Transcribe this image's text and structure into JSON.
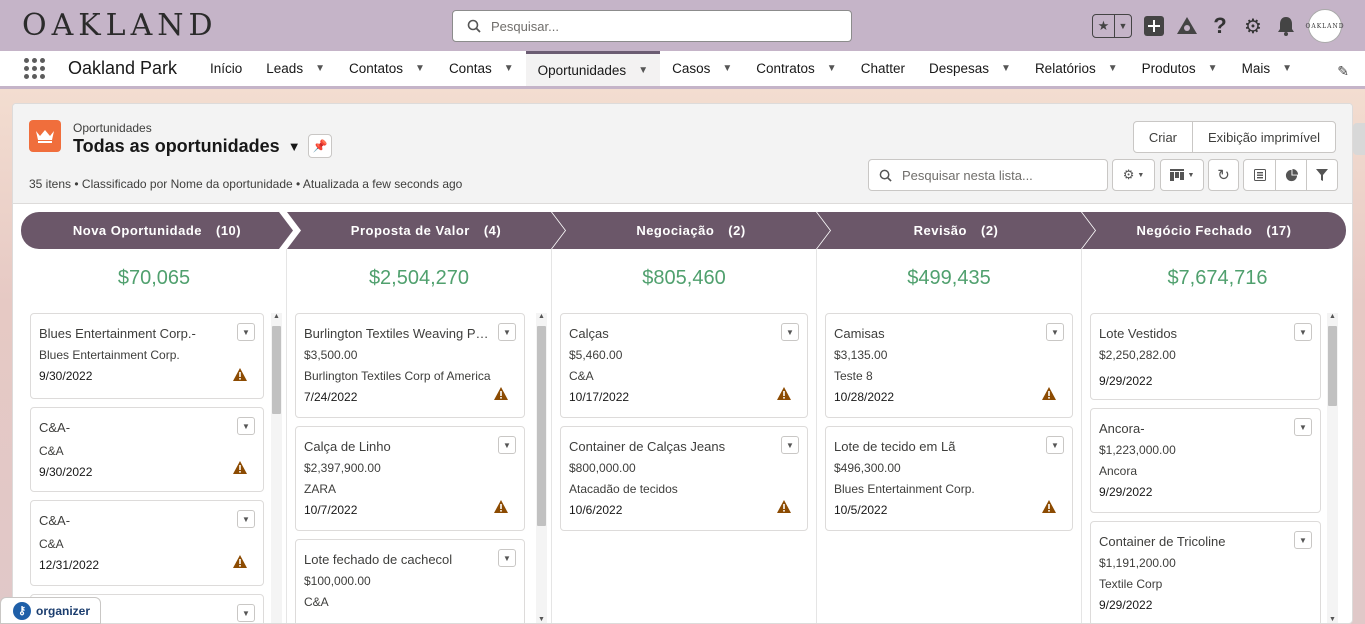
{
  "header": {
    "logo": "OAKLAND",
    "search_placeholder": "Pesquisar...",
    "avatar_text": "OAKLAND"
  },
  "nav": {
    "app_name": "Oakland Park",
    "items": [
      {
        "label": "Início",
        "chevron": false
      },
      {
        "label": "Leads",
        "chevron": true
      },
      {
        "label": "Contatos",
        "chevron": true
      },
      {
        "label": "Contas",
        "chevron": true
      },
      {
        "label": "Oportunidades",
        "chevron": true,
        "active": true
      },
      {
        "label": "Casos",
        "chevron": true
      },
      {
        "label": "Contratos",
        "chevron": true
      },
      {
        "label": "Chatter",
        "chevron": false
      },
      {
        "label": "Despesas",
        "chevron": true
      },
      {
        "label": "Relatórios",
        "chevron": true
      },
      {
        "label": "Produtos",
        "chevron": true
      },
      {
        "label": "Mais",
        "chevron": true
      }
    ]
  },
  "list": {
    "object_label": "Oportunidades",
    "title": "Todas as oportunidades",
    "meta": "35 itens • Classificado por Nome da oportunidade • Atualizada a few seconds ago",
    "btn_create": "Criar",
    "btn_print": "Exibição imprimível",
    "search_placeholder": "Pesquisar nesta lista..."
  },
  "stages": [
    {
      "name": "Nova Oportunidade",
      "count": "(10)",
      "sum": "$70,065",
      "cards": [
        {
          "name": "Blues Entertainment Corp.-",
          "lines": [
            "Blues Entertainment Corp."
          ],
          "date": "9/30/2022",
          "warn": true
        },
        {
          "name": "C&A-",
          "lines": [
            "C&A"
          ],
          "date": "9/30/2022",
          "warn": true
        },
        {
          "name": "C&A-",
          "lines": [
            "C&A"
          ],
          "date": "12/31/2022",
          "warn": true
        }
      ]
    },
    {
      "name": "Proposta de Valor",
      "count": "(4)",
      "sum": "$2,504,270",
      "cards": [
        {
          "name": "Burlington Textiles Weaving Pla...",
          "lines": [
            "$3,500.00",
            "Burlington Textiles Corp of America"
          ],
          "date": "7/24/2022",
          "warn": true
        },
        {
          "name": "Calça de Linho",
          "lines": [
            "$2,397,900.00",
            "ZARA"
          ],
          "date": "10/7/2022",
          "warn": true
        },
        {
          "name": "Lote fechado de cachecol",
          "lines": [
            "$100,000.00",
            "C&A"
          ],
          "date": "",
          "warn": true
        }
      ]
    },
    {
      "name": "Negociação",
      "count": "(2)",
      "sum": "$805,460",
      "cards": [
        {
          "name": "Calças",
          "lines": [
            "$5,460.00",
            "C&A"
          ],
          "date": "10/17/2022",
          "warn": true
        },
        {
          "name": "Container de Calças Jeans",
          "lines": [
            "$800,000.00",
            "Atacadão de tecidos"
          ],
          "date": "10/6/2022",
          "warn": true
        }
      ]
    },
    {
      "name": "Revisão",
      "count": "(2)",
      "sum": "$499,435",
      "cards": [
        {
          "name": "Camisas",
          "lines": [
            "$3,135.00",
            "Teste 8"
          ],
          "date": "10/28/2022",
          "warn": true
        },
        {
          "name": "Lote de tecido em Lã",
          "lines": [
            "$496,300.00",
            "Blues Entertainment Corp."
          ],
          "date": "10/5/2022",
          "warn": true
        }
      ]
    },
    {
      "name": "Negócio Fechado",
      "count": "(17)",
      "sum": "$7,674,716",
      "cards": [
        {
          "name": "Lote Vestidos",
          "lines": [
            "$2,250,282.00",
            ""
          ],
          "date": "9/29/2022",
          "warn": false
        },
        {
          "name": "Ancora-",
          "lines": [
            "$1,223,000.00",
            "Ancora"
          ],
          "date": "9/29/2022",
          "warn": false
        },
        {
          "name": "Container de Tricoline",
          "lines": [
            "$1,191,200.00",
            "Textile Corp"
          ],
          "date": "9/29/2022",
          "warn": false
        }
      ]
    }
  ],
  "organizer": {
    "label": "organizer"
  },
  "colors": {
    "stage_bg": "#6b5769",
    "sum_green": "#50a06e",
    "header_bg": "#c5b4c8",
    "warn": "#8c4b02"
  }
}
